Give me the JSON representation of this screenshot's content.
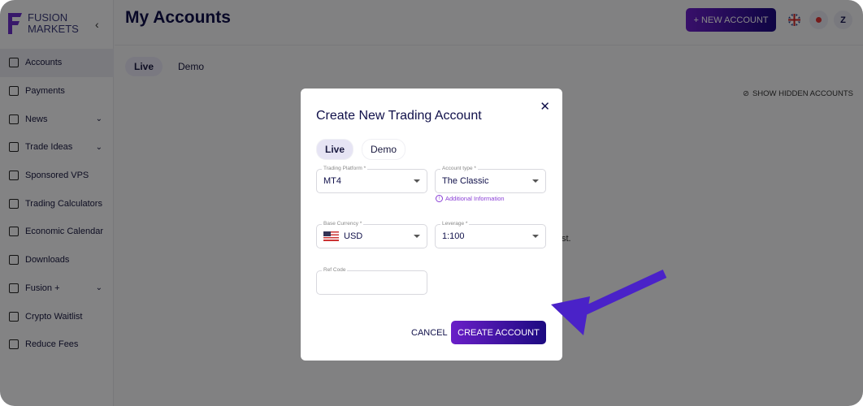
{
  "brand": {
    "line1": "FUSION",
    "line2": "MARKETS"
  },
  "sidebar": {
    "items": [
      {
        "label": "Accounts",
        "icon": "user-icon",
        "active": true
      },
      {
        "label": "Payments",
        "icon": "wallet-icon"
      },
      {
        "label": "News",
        "icon": "newspaper-icon",
        "expand": true
      },
      {
        "label": "Trade Ideas",
        "icon": "chart-icon",
        "expand": true
      },
      {
        "label": "Sponsored VPS",
        "icon": "document-icon"
      },
      {
        "label": "Trading Calculators",
        "icon": "calculator-icon"
      },
      {
        "label": "Economic Calendar",
        "icon": "calendar-icon"
      },
      {
        "label": "Downloads",
        "icon": "download-icon"
      },
      {
        "label": "Fusion +",
        "icon": "group-icon",
        "expand": true
      },
      {
        "label": "Crypto Waitlist",
        "icon": "clock-icon"
      },
      {
        "label": "Reduce Fees",
        "icon": "trend-down-icon"
      }
    ]
  },
  "header": {
    "title": "My Accounts",
    "new_account": "+ NEW ACCOUNT",
    "avatar": "Z"
  },
  "page": {
    "tabs": [
      "Live",
      "Demo"
    ],
    "show_hidden": "SHOW HIDDEN ACCOUNTS",
    "partial_text": "st."
  },
  "modal": {
    "title": "Create New Trading Account",
    "tabs": [
      "Live",
      "Demo"
    ],
    "platform": {
      "label": "Trading Platform *",
      "value": "MT4"
    },
    "account_type": {
      "label": "Account type *",
      "value": "The Classic"
    },
    "additional_info": "Additional Information",
    "currency": {
      "label": "Base Currency *",
      "value": "USD"
    },
    "leverage": {
      "label": "Leverage *",
      "value": "1:100"
    },
    "ref_code": {
      "label": "Ref Code",
      "value": ""
    },
    "cancel": "CANCEL",
    "create": "CREATE ACCOUNT"
  },
  "colors": {
    "accent": "#6a1fc8",
    "navy": "#10104a",
    "annotation_arrow": "#4a22c8"
  }
}
